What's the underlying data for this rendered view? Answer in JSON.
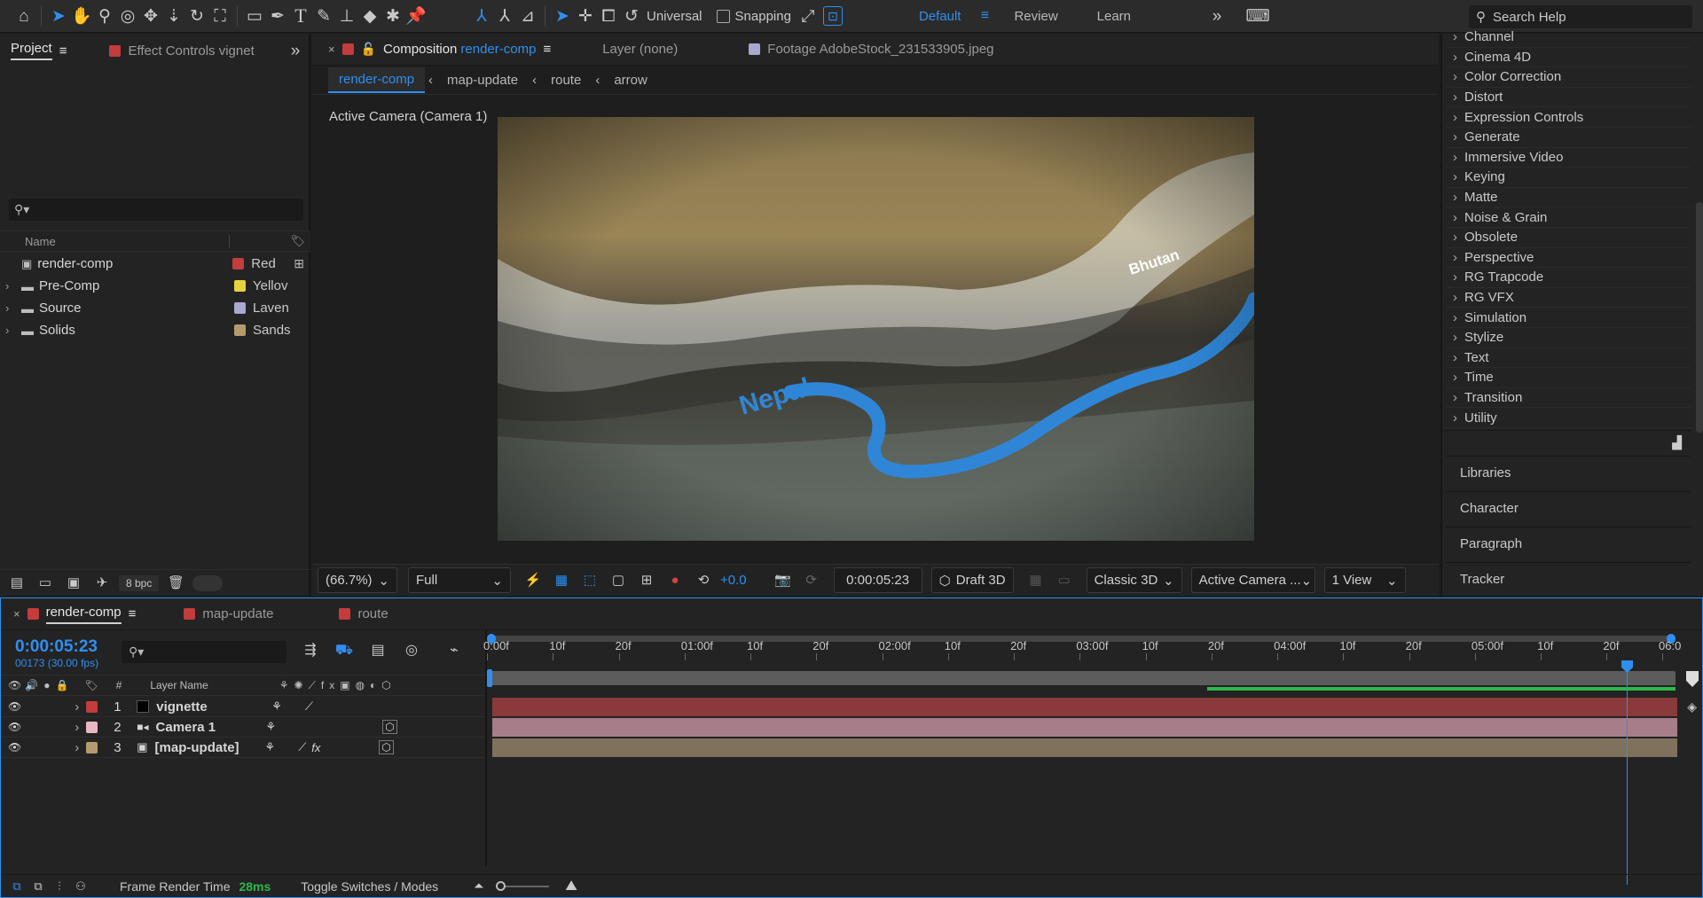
{
  "toolbar": {
    "universal": "Universal",
    "snapping": "Snapping",
    "workspaces": [
      "Default",
      "Review",
      "Learn"
    ],
    "search_placeholder": "Search Help"
  },
  "project_panel": {
    "tabs": [
      {
        "label": "Project"
      },
      {
        "label": "Effect Controls vignet"
      }
    ],
    "search_value": "",
    "col_name": "Name",
    "items": [
      {
        "name": "render-comp",
        "label": "Red",
        "color": "#c43c3c",
        "type": "comp"
      },
      {
        "name": "Pre-Comp",
        "label": "Yellov",
        "color": "#e6d23f",
        "type": "folder"
      },
      {
        "name": "Source",
        "label": "Laven",
        "color": "#a7a7d0",
        "type": "folder"
      },
      {
        "name": "Solids",
        "label": "Sands",
        "color": "#b59a6e",
        "type": "folder"
      }
    ],
    "bpc": "8 bpc"
  },
  "comp_panel": {
    "tab_prefix": "Composition",
    "tab_comp": "render-comp",
    "tab_layer": "Layer (none)",
    "tab_footage": "Footage AdobeStock_231533905.jpeg",
    "breadcrumbs": [
      "render-comp",
      "map-update",
      "route",
      "arrow"
    ],
    "active_camera": "Active Camera (Camera 1)",
    "map_labels": {
      "nepal": "Nepal",
      "bhutan": "Bhutan"
    },
    "zoom": "(66.7%)",
    "resolution": "Full",
    "exposure": "+0.0",
    "timecode": "0:00:05:23",
    "draft3d": "Draft 3D",
    "renderer": "Classic 3D",
    "camera": "Active Camera ...",
    "views": "1 View"
  },
  "effects": [
    "Channel",
    "Cinema 4D",
    "Color Correction",
    "Distort",
    "Expression Controls",
    "Generate",
    "Immersive Video",
    "Keying",
    "Matte",
    "Noise & Grain",
    "Obsolete",
    "Perspective",
    "RG Trapcode",
    "RG VFX",
    "Simulation",
    "Stylize",
    "Text",
    "Time",
    "Transition",
    "Utility"
  ],
  "side_panels": [
    "Libraries",
    "Character",
    "Paragraph",
    "Tracker"
  ],
  "timeline": {
    "tabs": [
      {
        "label": "render-comp",
        "color": "#c43c3c"
      },
      {
        "label": "map-update",
        "color": "#c43c3c"
      },
      {
        "label": "route",
        "color": "#c43c3c"
      }
    ],
    "timecode": "0:00:05:23",
    "frames": "00173 (30.00 fps)",
    "search_value": "",
    "col_hash": "#",
    "col_layername": "Layer Name",
    "ruler_labels": [
      "0:00f",
      "10f",
      "20f",
      "01:00f",
      "10f",
      "20f",
      "02:00f",
      "10f",
      "20f",
      "03:00f",
      "10f",
      "20f",
      "04:00f",
      "10f",
      "20f",
      "05:00f",
      "10f",
      "20f",
      "06:0"
    ],
    "layers": [
      {
        "num": "1",
        "name": "vignette",
        "color": "#c43c3c",
        "bar": "#8a3a3a"
      },
      {
        "num": "2",
        "name": "Camera 1",
        "color": "#e7b8c4",
        "bar": "#a77d89"
      },
      {
        "num": "3",
        "name": "[map-update]",
        "color": "#b59a6e",
        "bar": "#7f715b"
      }
    ],
    "playhead_fraction": 0.959,
    "work_area_start_fraction": 0.606,
    "frame_render_label": "Frame Render Time",
    "frame_render_value": "28ms",
    "toggle_label": "Toggle Switches / Modes"
  }
}
